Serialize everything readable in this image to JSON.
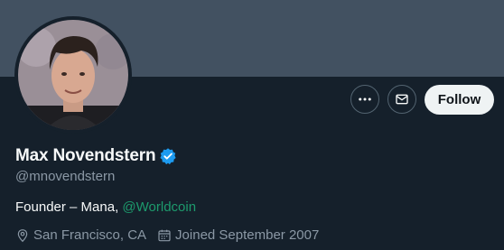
{
  "profile": {
    "display_name": "Max Novendstern",
    "handle": "@mnovendstern",
    "verified": true,
    "bio_prefix": "Founder – Mana, ",
    "bio_mention": "@Worldcoin",
    "location": "San Francisco, CA",
    "joined": "Joined September 2007"
  },
  "actions": {
    "more_icon": "more-horizontal-icon",
    "message_icon": "envelope-icon",
    "follow_label": "Follow"
  },
  "colors": {
    "background": "#15202b",
    "banner": "#425161",
    "verified_badge": "#1d9bf0",
    "mention": "#1d9b6d",
    "secondary_text": "#8b98a5",
    "follow_button_bg": "#eff3f4"
  }
}
